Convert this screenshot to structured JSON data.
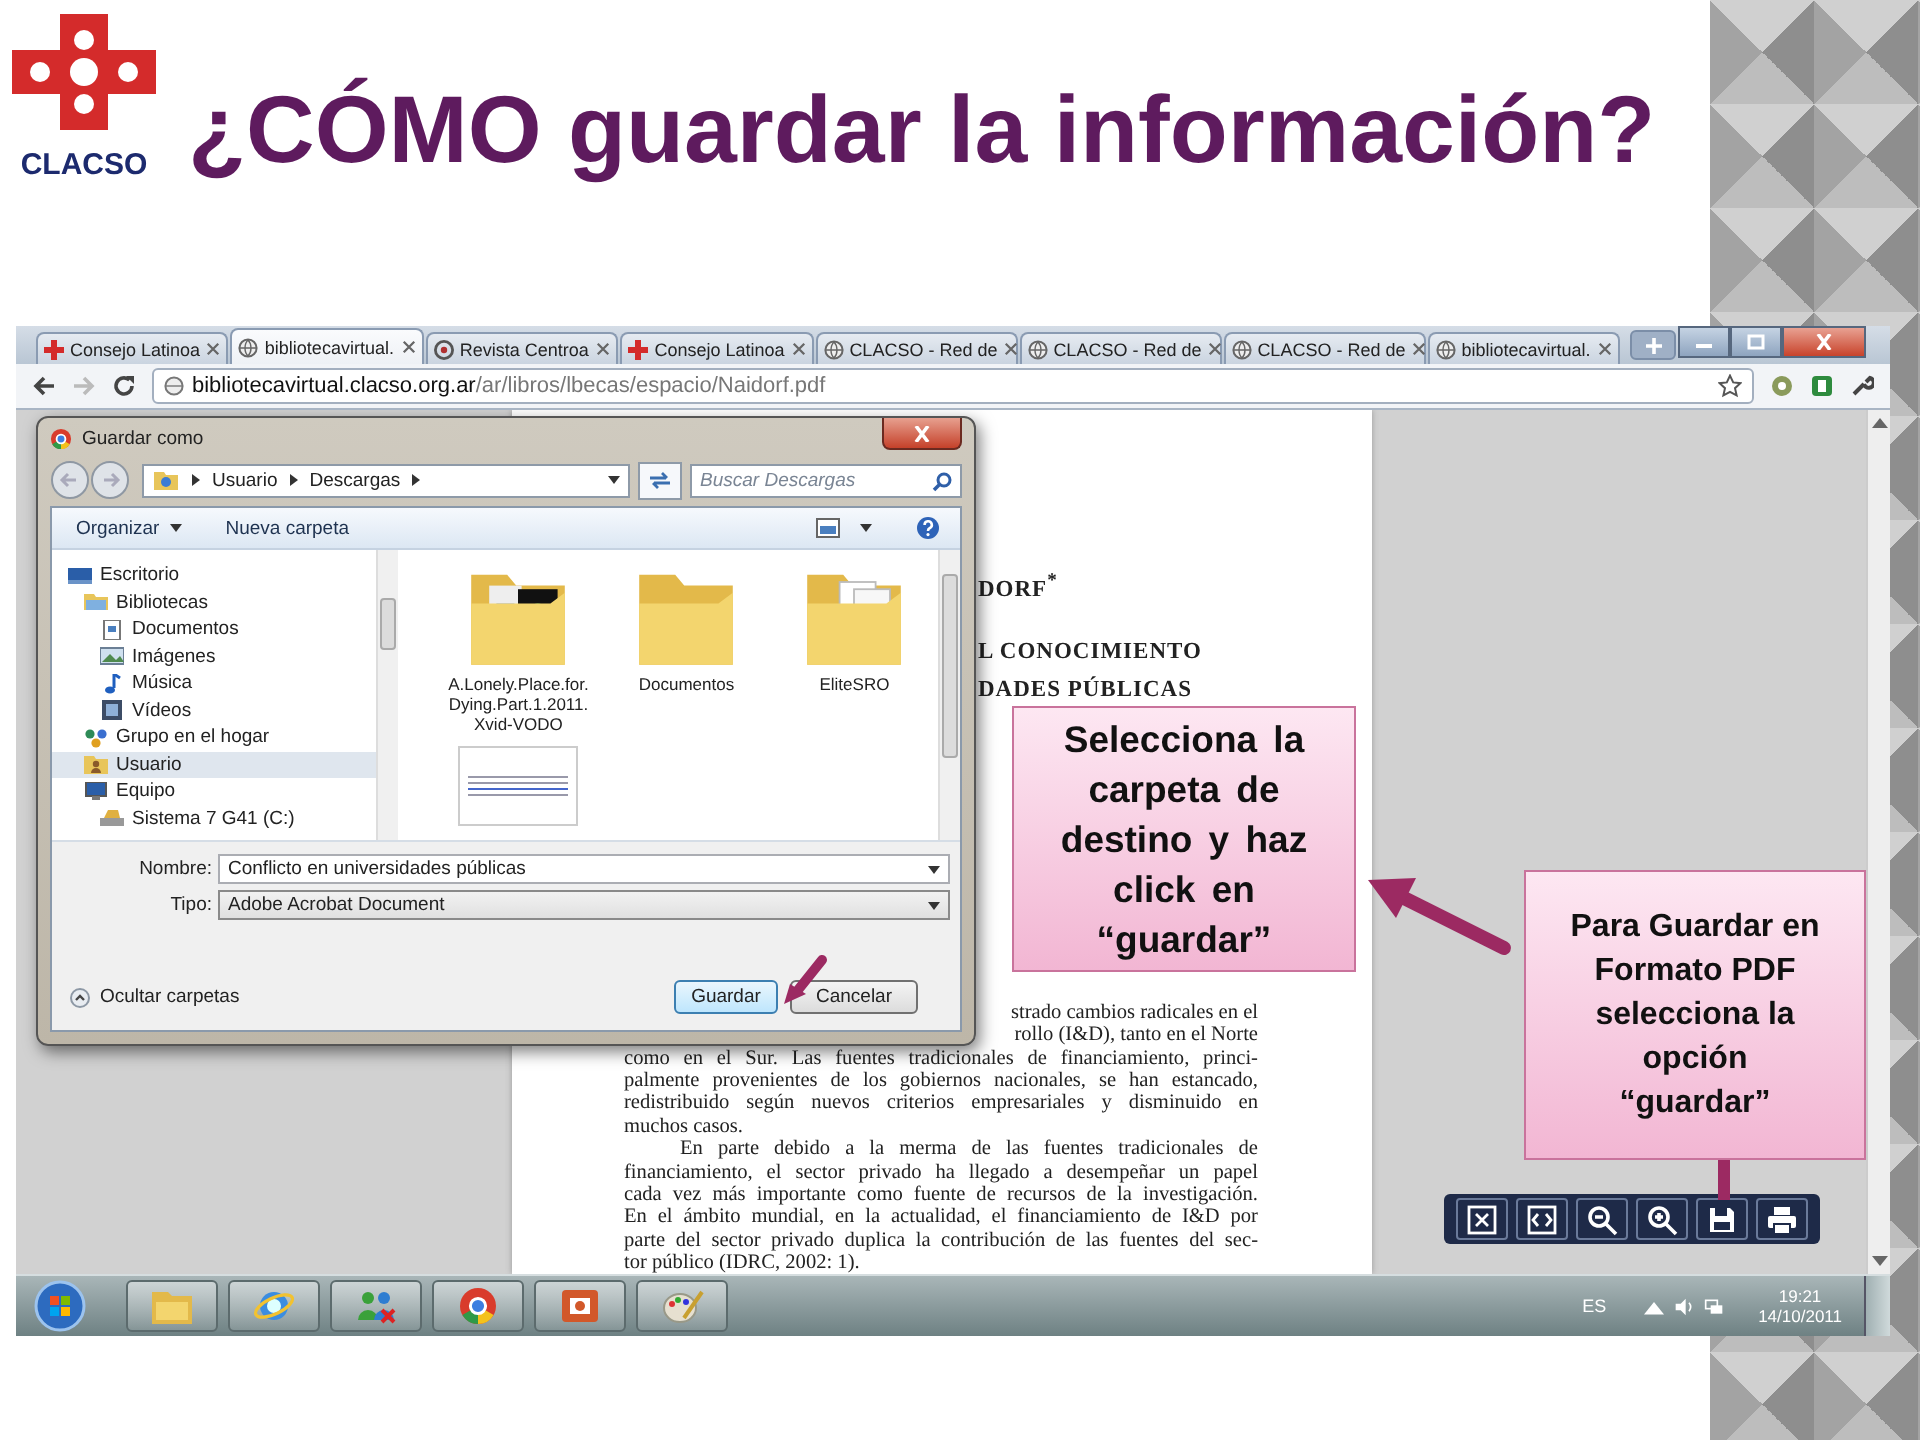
{
  "logo": {
    "text": "CLACSO"
  },
  "title": "¿CÓMO guardar la información?",
  "browser": {
    "tabs": [
      {
        "label": "Consejo Latinoa",
        "selected": false
      },
      {
        "label": "bibliotecavirtual.",
        "selected": true
      },
      {
        "label": "Revista Centroa",
        "selected": false
      },
      {
        "label": "Consejo Latinoa",
        "selected": false
      },
      {
        "label": "CLACSO - Red de",
        "selected": false
      },
      {
        "label": "CLACSO - Red de",
        "selected": false
      },
      {
        "label": "CLACSO - Red de",
        "selected": false
      },
      {
        "label": "bibliotecavirtual.",
        "selected": false
      }
    ],
    "url": {
      "host": "bibliotecavirtual.clacso.org.ar",
      "path": "/ar/libros/lbecas/espacio/Naidorf.pdf"
    }
  },
  "document": {
    "headings": [
      "DORF$^{*}$",
      "L CONOCIMIENTO",
      "DADES PÚBLICAS"
    ],
    "paragraphs": [
      {
        "indent": false,
        "covered_lines": [
          "strado cambios radicales en el",
          "rollo (I&D), tanto en el Norte"
        ],
        "lines": [
          "como en el Sur. Las fuentes tradicionales de financiamiento, princi-",
          "palmente provenientes de los gobiernos nacionales, se han estancado,",
          "redistribuido según nuevos criterios empresariales y disminuido en",
          "muchos casos."
        ]
      },
      {
        "indent": true,
        "lines": [
          "En parte debido a la merma de las fuentes tradicionales de",
          "financiamiento, el sector privado ha llegado a desempeñar un papel",
          "cada vez más importante como fuente de recursos de la investigación.",
          "En el ámbito mundial, en la actualidad, el financiamiento de I&D por",
          "parte del sector privado duplica la contribución de las fuentes del sec-",
          "tor público (IDRC, 2002: 1)."
        ]
      }
    ]
  },
  "dialog": {
    "title": "Guardar como",
    "breadcrumb": [
      "Usuario",
      "Descargas"
    ],
    "search": {
      "placeholder": "Buscar Descargas"
    },
    "commands": [
      {
        "label": "Organizar",
        "menu": true
      },
      {
        "label": "Nueva carpeta",
        "menu": false
      }
    ],
    "tree": [
      {
        "label": "Escritorio",
        "selected": false,
        "children": [
          {
            "label": "Bibliotecas",
            "selected": false,
            "children": [
              {
                "label": "Documentos",
                "selected": false
              },
              {
                "label": "Imágenes",
                "selected": false
              },
              {
                "label": "Música",
                "selected": false
              },
              {
                "label": "Vídeos",
                "selected": false
              }
            ]
          },
          {
            "label": "Grupo en el hogar",
            "selected": false
          },
          {
            "label": "Usuario",
            "selected": true
          },
          {
            "label": "Equipo",
            "selected": false,
            "children": [
              {
                "label": "Sistema 7 G41 (C:)",
                "selected": false
              }
            ]
          }
        ]
      }
    ],
    "files": [
      {
        "kind": "media-folder",
        "name": "A.Lonely.Place.for.Dying.Part.1.2011.Xvid-VODO"
      },
      {
        "kind": "folder",
        "name": "Documentos"
      },
      {
        "kind": "document-folder",
        "name": "EliteSRO"
      },
      {
        "kind": "thumbnail"
      }
    ],
    "fields": [
      {
        "label": "Nombre:",
        "value": "Conflicto en universidades públicas",
        "editable": true
      },
      {
        "label": "Tipo:",
        "value": "Adobe Acrobat Document",
        "editable": false
      }
    ],
    "hide_folders": "Ocultar carpetas",
    "buttons": [
      {
        "label": "Guardar",
        "default": true
      },
      {
        "label": "Cancelar",
        "default": false
      }
    ]
  },
  "callouts": [
    "Selecciona la carpeta de destino y haz click en “guardar”",
    "Para Guardar en Formato PDF selecciona la opción “guardar”"
  ],
  "taskbar": {
    "language": "ES",
    "time": "19:21",
    "date": "14/10/2011"
  }
}
